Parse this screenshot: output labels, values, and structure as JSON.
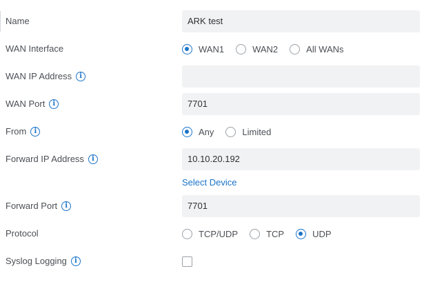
{
  "form": {
    "name": {
      "label": "Name",
      "value": "ARK test"
    },
    "wan_interface": {
      "label": "WAN Interface",
      "options": [
        "WAN1",
        "WAN2",
        "All WANs"
      ],
      "selected": "WAN1"
    },
    "wan_ip_address": {
      "label": "WAN IP Address",
      "value": ""
    },
    "wan_port": {
      "label": "WAN Port",
      "value": "7701"
    },
    "from": {
      "label": "From",
      "options": [
        "Any",
        "Limited"
      ],
      "selected": "Any"
    },
    "forward_ip_address": {
      "label": "Forward IP Address",
      "value": "10.10.20.192",
      "select_device_label": "Select Device"
    },
    "forward_port": {
      "label": "Forward Port",
      "value": "7701"
    },
    "protocol": {
      "label": "Protocol",
      "options": [
        "TCP/UDP",
        "TCP",
        "UDP"
      ],
      "selected": "UDP"
    },
    "syslog_logging": {
      "label": "Syslog Logging",
      "checked": false
    }
  },
  "colors": {
    "accent": "#1a73c8",
    "field_bg": "#f1f2f4",
    "label_text": "#4b4f55"
  },
  "icons": {
    "info": "info-circle-icon"
  }
}
